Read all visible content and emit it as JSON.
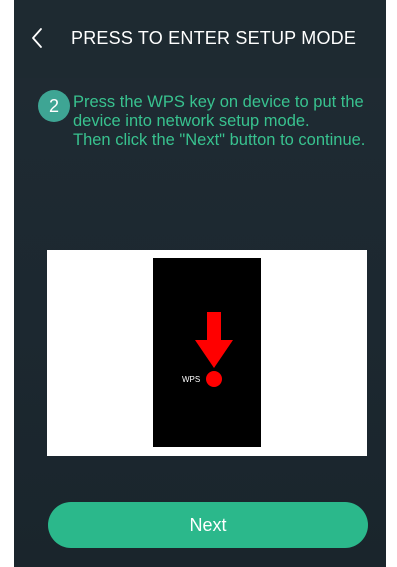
{
  "header": {
    "back_icon": "chevron-left-icon",
    "title": "PRESS TO ENTER SETUP MODE"
  },
  "instruction": {
    "step_number": "2",
    "lines": [
      "Press the WPS key on device to put the device into network setup mode.",
      "Then click the \"Next\" button to continue."
    ]
  },
  "illustration": {
    "wps_label": "WPS",
    "arrow_color": "#ff0000",
    "device_color": "#000000"
  },
  "footer": {
    "next_label": "Next"
  },
  "colors": {
    "accent": "#2bb88b",
    "instruction_text": "#38c28f",
    "badge": "#3ea594",
    "background": "#1e2a31"
  }
}
